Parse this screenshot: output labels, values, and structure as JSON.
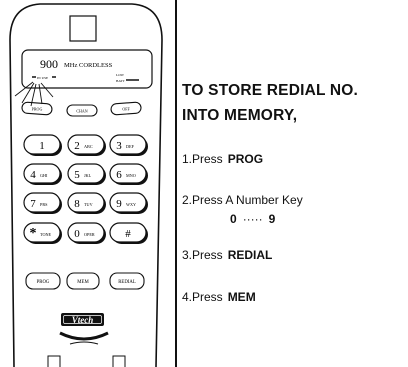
{
  "phone": {
    "display": {
      "freq": "900",
      "freq_unit": "MHz CORDLESS",
      "in_use": "IN USE",
      "low": "LOW",
      "batt": "BATT"
    },
    "func_keys": [
      "PROG",
      "CHAN",
      "OFF"
    ],
    "keypad": [
      {
        "num": "1",
        "sub": ""
      },
      {
        "num": "2",
        "sub": "ABC"
      },
      {
        "num": "3",
        "sub": "DEF"
      },
      {
        "num": "4",
        "sub": "GHI"
      },
      {
        "num": "5",
        "sub": "JKL"
      },
      {
        "num": "6",
        "sub": "MNO"
      },
      {
        "num": "7",
        "sub": "PRS"
      },
      {
        "num": "8",
        "sub": "TUV"
      },
      {
        "num": "9",
        "sub": "WXY"
      },
      {
        "num": "*",
        "sub": "TONE"
      },
      {
        "num": "0",
        "sub": "OPER"
      },
      {
        "num": "#",
        "sub": ""
      }
    ],
    "bottom_keys": [
      "PROG",
      "MEM",
      "REDIAL"
    ],
    "brand": "Vtech"
  },
  "instructions": {
    "heading_line1": "TO STORE REDIAL NO.",
    "heading_line2": "INTO MEMORY,",
    "steps": [
      {
        "text": "1.Press",
        "key": "PROG"
      },
      {
        "text": "2.Press A Number Key",
        "key": ""
      },
      {
        "text": "3.Press",
        "key": "REDIAL"
      },
      {
        "text": "4.Press",
        "key": "MEM"
      }
    ],
    "range": {
      "from": "0",
      "dots": "·····",
      "to": "9"
    }
  }
}
